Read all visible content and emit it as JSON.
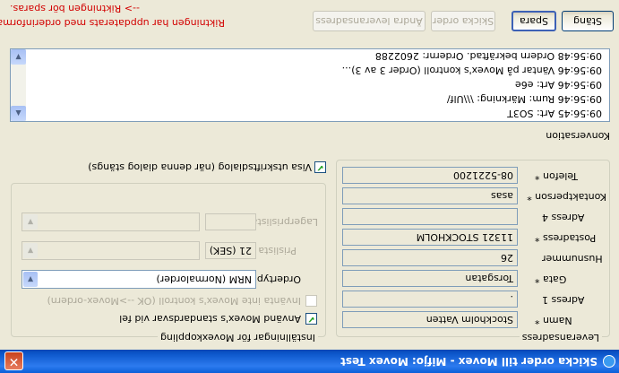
{
  "window": {
    "title": "Skicka order till Movex - Mifjo: Movex Test"
  },
  "delivery_address": {
    "group_title": "Leveransadress",
    "fields": [
      {
        "label": "Namn",
        "required": true,
        "value": "Stockholm Vatten"
      },
      {
        "label": "Adress 1",
        "required": false,
        "value": "."
      },
      {
        "label": "Gata",
        "required": true,
        "value": "Torsgatan"
      },
      {
        "label": "Husnummer",
        "required": false,
        "value": "26"
      },
      {
        "label": "Postadress",
        "required": true,
        "value": "11321 STOCKHOLM"
      },
      {
        "label": "Adress 4",
        "required": false,
        "value": ""
      },
      {
        "label": "Kontaktperson",
        "required": true,
        "value": "asas"
      },
      {
        "label": "Telefon",
        "required": true,
        "value": "08-5221200"
      }
    ],
    "required_marker": "*"
  },
  "movex_settings": {
    "group_title": "Inställningar för Movexkoppling",
    "use_defaults": {
      "label": "Använd Movex's standardsvar vid fel",
      "checked": true
    },
    "skip_control": {
      "label": "Invänta inte Movex's kontroll (OK -->Movex-ordern)",
      "checked": false
    },
    "order_type": {
      "label": "Ordertyp",
      "value": "NRM (Normalorder)"
    },
    "price_list": {
      "label": "Prislista",
      "code": "21 (SEK)",
      "value": ""
    },
    "warehouse_price_list": {
      "label": "Lagerprislista",
      "code": "",
      "value": ""
    }
  },
  "show_print_dialog": {
    "label": "Visa utskriftsdialog (när denna dialog stängs)",
    "checked": true
  },
  "conversation": {
    "title": "Konversation",
    "lines": [
      "09:56:45 Art: SO3T",
      "09:56:46 Rum: Märkning: \\\\\\Ulf/",
      "09:56:46 Art: e6e",
      "09:56:46 Väntar på Movex's kontroll (Order 3 av 3)...",
      "09:56:48 Ordern bekräftad. Ordernr: 2602288"
    ]
  },
  "status": {
    "line1": "Riktningen har uppdaterats med orderinformation.",
    "line2": "--> Riktningen bör sparas."
  },
  "buttons": {
    "change_address": "Ändra leveransadress",
    "send_order": "Skicka order",
    "save": "Spara",
    "close": "Stäng"
  },
  "icons": {
    "app": "app-icon",
    "close": "close-icon",
    "check": "✔",
    "dropdown": "▼",
    "scroll_up": "▲",
    "scroll_down": "▼"
  }
}
